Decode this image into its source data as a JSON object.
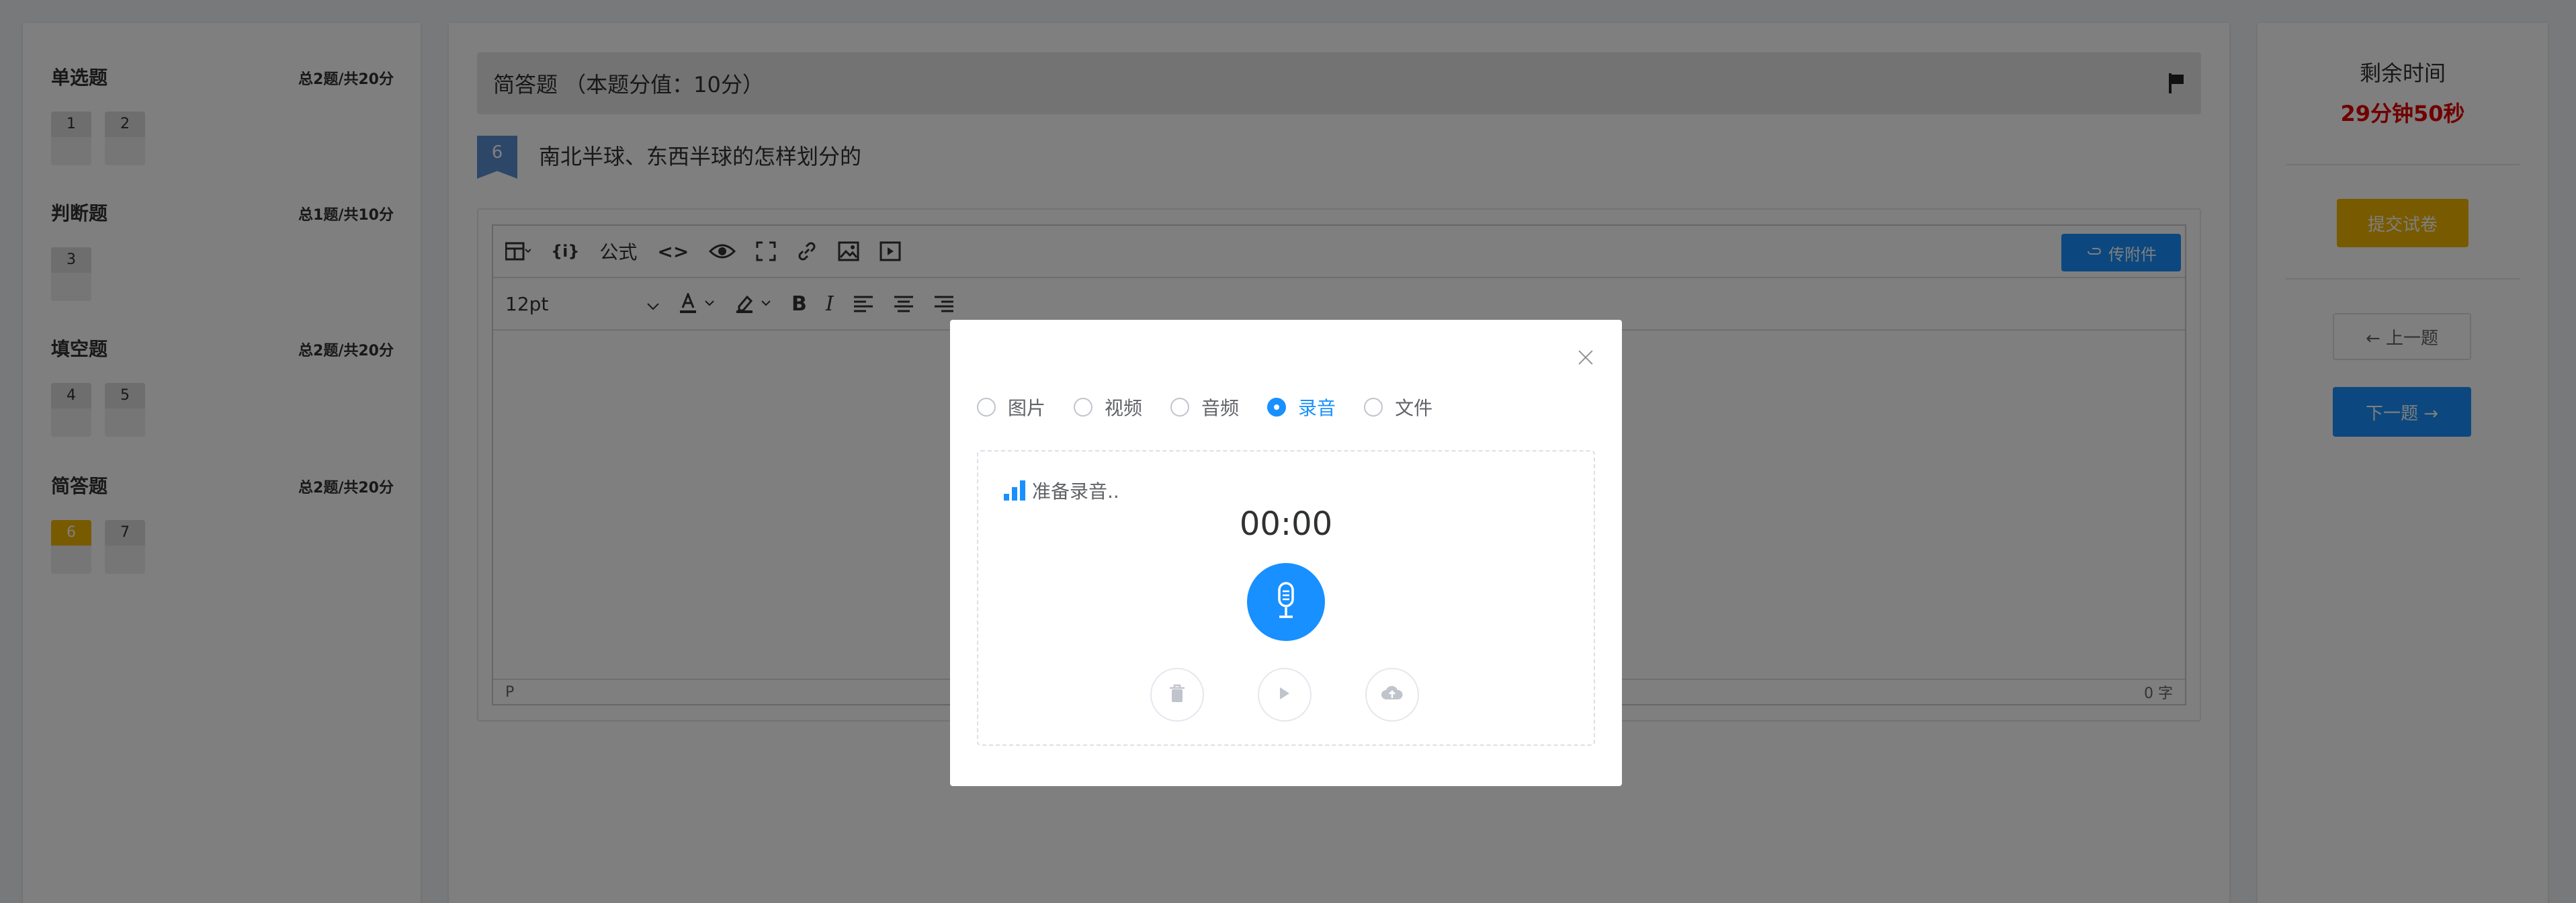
{
  "sidebar": {
    "sections": [
      {
        "title": "单选题",
        "meta": "总2题/共20分",
        "numbers": [
          "1",
          "2"
        ]
      },
      {
        "title": "判断题",
        "meta": "总1题/共10分",
        "numbers": [
          "3"
        ]
      },
      {
        "title": "填空题",
        "meta": "总2题/共20分",
        "numbers": [
          "4",
          "5"
        ]
      },
      {
        "title": "简答题",
        "meta": "总2题/共20分",
        "numbers": [
          "6",
          "7"
        ]
      }
    ],
    "active_number": "6"
  },
  "question": {
    "type_label": "简答题 （本题分值：10分）",
    "number": "6",
    "text": "南北半球、东西半球的怎样划分的"
  },
  "editor": {
    "formula_label": "公式",
    "font_size": "12pt",
    "upload_label": "传附件",
    "status_path": "P",
    "word_count": "0 字"
  },
  "timer": {
    "label": "剩余时间",
    "value": "29分钟50秒"
  },
  "actions": {
    "submit": "提交试卷",
    "prev": "← 上一题",
    "next": "下一题 →"
  },
  "modal": {
    "options": [
      "图片",
      "视频",
      "音频",
      "录音",
      "文件"
    ],
    "selected": "录音",
    "status": "准备录音..",
    "time": "00:00"
  },
  "colors": {
    "primary": "#1890ff",
    "warning": "#f0b400",
    "danger": "#e00000"
  }
}
